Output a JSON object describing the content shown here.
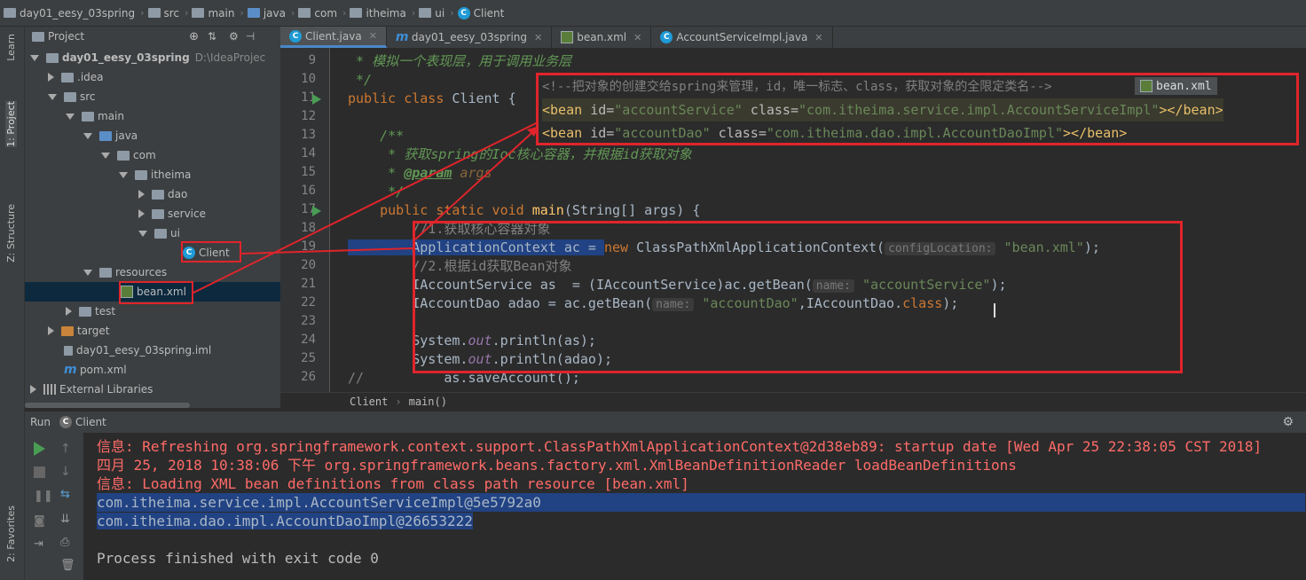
{
  "breadcrumb": [
    "day01_eesy_03spring",
    "src",
    "main",
    "java",
    "com",
    "itheima",
    "ui",
    "Client"
  ],
  "stripe": {
    "learn": "Learn",
    "project": "1: Project",
    "structure": "Z: Structure",
    "favorites": "2: Favorites"
  },
  "project_panel": {
    "title": "Project",
    "tree": [
      {
        "label": "day01_eesy_03spring",
        "suffix": "D:\\IdeaProjec"
      },
      {
        "label": ".idea"
      },
      {
        "label": "src"
      },
      {
        "label": "main"
      },
      {
        "label": "java"
      },
      {
        "label": "com"
      },
      {
        "label": "itheima"
      },
      {
        "label": "dao"
      },
      {
        "label": "service"
      },
      {
        "label": "ui"
      },
      {
        "label": "Client"
      },
      {
        "label": "resources"
      },
      {
        "label": "bean.xml"
      },
      {
        "label": "test"
      },
      {
        "label": "target"
      },
      {
        "label": "day01_eesy_03spring.iml"
      },
      {
        "label": "pom.xml"
      },
      {
        "label": "External Libraries"
      }
    ]
  },
  "tabs": [
    {
      "label": "Client.java",
      "active": true
    },
    {
      "label": "day01_eesy_03spring",
      "active": false
    },
    {
      "label": "bean.xml",
      "active": false
    },
    {
      "label": "AccountServiceImpl.java",
      "active": false
    }
  ],
  "line_numbers": [
    "9",
    "10",
    "11",
    "12",
    "13",
    "14",
    "15",
    "16",
    "17",
    "18",
    "19",
    "20",
    "21",
    "22",
    "23",
    "24",
    "25",
    "26"
  ],
  "code": {
    "l9": " * 模拟一个表现层，用于调用业务层",
    "l10": " */",
    "l11a": "public class ",
    "l11b": "Client {",
    "l13": "    /**",
    "l14a": "     * 获取",
    "l14b": "spring",
    "l14c": "的",
    "l14d": "Ioc",
    "l14e": "核心容器，并根据",
    "l14f": "id",
    "l14g": "获取对象",
    "l15a": "     * ",
    "l15b": "@param",
    "l15c": " args",
    "l16": "     */",
    "l17a": "    public static void ",
    "l17b": "main",
    "l17c": "(String[] args) {",
    "l18": "        //1.获取核心容器对象",
    "l19a": "        ApplicationContext ac = ",
    "l19b": "new ",
    "l19c": "ClassPathXmlApplicationContext(",
    "l19hint": "configLocation:",
    "l19d": " \"bean.xml\"",
    "l19e": ");",
    "l20": "        //2.根据id获取Bean对象",
    "l21a": "        IAccountService as  = (IAccountService)ac.getBean(",
    "l21hint": "name:",
    "l21b": " \"accountService\"",
    "l21c": ");",
    "l22a": "        IAccountDao adao = ac.getBean(",
    "l22hint": "name:",
    "l22b": " \"accountDao\"",
    "l22c": ",IAccountDao.",
    "l22d": "class",
    "l22e": ");",
    "l24a": "        System.",
    "l24b": "out",
    "l24c": ".println(as);",
    "l25a": "        System.",
    "l25b": "out",
    "l25c": ".println(adao);",
    "l26a": "//",
    "l26b": "          as.saveAccount();"
  },
  "editor_breadcrumb": [
    "Client",
    "main()"
  ],
  "xml_popup": {
    "comment": "<!--把对象的创建交给spring来管理，id，唯一标志、class，获取对象的全限定类名-->",
    "badge": "bean.xml",
    "line2": {
      "open": "<bean ",
      "id_attr": "id=",
      "id_val": "\"accountService\"",
      "class_attr": " class=",
      "class_val": "\"com.itheima.service.impl.AccountServiceImpl\"",
      "close": "></bean>"
    },
    "line3": {
      "open": "<bean ",
      "id_attr": "id=",
      "id_val": "\"accountDao\"",
      "class_attr": " class=",
      "class_val": "\"com.itheima.dao.impl.AccountDaoImpl\"",
      "close": "></bean>"
    }
  },
  "run_panel": {
    "label": "Run",
    "config": "Client",
    "lines": [
      "信息: Refreshing org.springframework.context.support.ClassPathXmlApplicationContext@2d38eb89: startup date [Wed Apr 25 22:38:05 CST 2018]",
      "四月 25, 2018 10:38:06 下午 org.springframework.beans.factory.xml.XmlBeanDefinitionReader loadBeanDefinitions",
      "信息: Loading XML bean definitions from class path resource [bean.xml]",
      "com.itheima.service.impl.AccountServiceImpl@5e5792a0",
      "com.itheima.dao.impl.AccountDaoImpl@26653222",
      "",
      "Process finished with exit code 0"
    ]
  },
  "colors": {
    "highlight_red": "#e0242b",
    "selection": "#214283",
    "error_text": "#ff6b68"
  }
}
